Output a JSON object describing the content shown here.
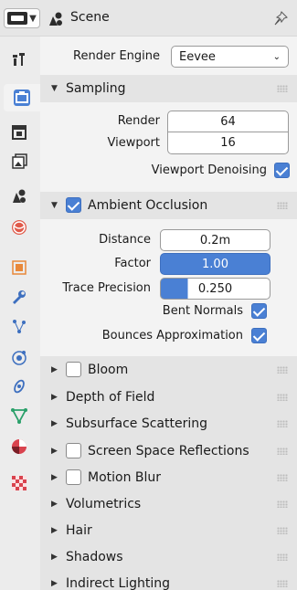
{
  "header": {
    "title": "Scene",
    "editor_type_icon": "properties-editor-icon",
    "scene_icon": "scene-icon",
    "pin_icon": "pin-icon"
  },
  "tabs": [
    {
      "name": "tool-tab",
      "icon": "tool-icon",
      "active": false
    },
    {
      "name": "render-tab",
      "icon": "render-icon",
      "active": true
    },
    {
      "name": "output-tab",
      "icon": "output-icon",
      "active": false
    },
    {
      "name": "view-layer-tab",
      "icon": "view-layer-icon",
      "active": false
    },
    {
      "name": "scene-tab",
      "icon": "scene-icon",
      "active": false
    },
    {
      "name": "world-tab",
      "icon": "world-icon",
      "active": false
    },
    {
      "name": "object-tab",
      "icon": "object-icon",
      "active": false
    },
    {
      "name": "modifier-tab",
      "icon": "wrench-icon",
      "active": false
    },
    {
      "name": "particles-tab",
      "icon": "particles-icon",
      "active": false
    },
    {
      "name": "physics-tab",
      "icon": "physics-icon",
      "active": false
    },
    {
      "name": "constraints-tab",
      "icon": "constraints-icon",
      "active": false
    },
    {
      "name": "data-tab",
      "icon": "mesh-data-icon",
      "active": false
    },
    {
      "name": "material-tab",
      "icon": "material-icon",
      "active": false
    },
    {
      "name": "texture-tab",
      "icon": "texture-icon",
      "active": false
    }
  ],
  "render_engine": {
    "label": "Render Engine",
    "value": "Eevee"
  },
  "sampling": {
    "title": "Sampling",
    "render_label": "Render",
    "render_value": "64",
    "viewport_label": "Viewport",
    "viewport_value": "16",
    "denoise_label": "Viewport Denoising",
    "denoise_checked": true
  },
  "ao": {
    "title": "Ambient Occlusion",
    "enabled": true,
    "distance_label": "Distance",
    "distance_value": "0.2m",
    "factor_label": "Factor",
    "factor_value": "1.00",
    "factor_fraction": 1.0,
    "trace_label": "Trace Precision",
    "trace_value": "0.250",
    "trace_fraction": 0.25,
    "bent_label": "Bent Normals",
    "bent_checked": true,
    "bounces_label": "Bounces Approximation",
    "bounces_checked": true
  },
  "panels": {
    "bloom": "Bloom",
    "dof": "Depth of Field",
    "sss": "Subsurface Scattering",
    "ssr": "Screen Space Reflections",
    "motion_blur": "Motion Blur",
    "volumetrics": "Volumetrics",
    "hair": "Hair",
    "shadows": "Shadows",
    "indirect": "Indirect Lighting"
  },
  "colors": {
    "accent": "#4a80d4",
    "background": "#f3f3f3",
    "panel_header": "#e4e4e4"
  }
}
